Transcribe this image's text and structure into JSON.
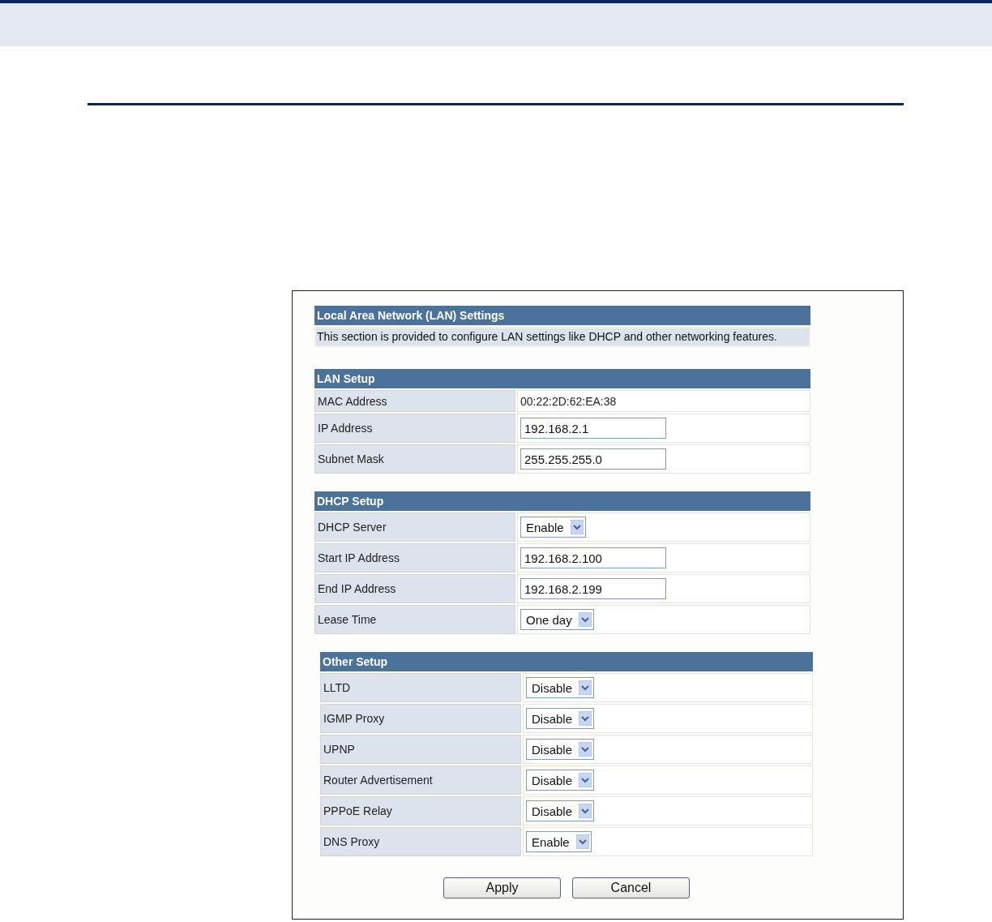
{
  "settings": {
    "title": "Local Area Network (LAN) Settings",
    "description": "This section is provided to configure LAN settings like DHCP and other networking features."
  },
  "sections": [
    {
      "title": "LAN Setup",
      "rows": [
        {
          "label": "MAC Address",
          "kind": "text",
          "value": "00:22:2D:62:EA:38"
        },
        {
          "label": "IP Address",
          "kind": "input",
          "value": "192.168.2.1"
        },
        {
          "label": "Subnet Mask",
          "kind": "input",
          "value": "255.255.255.0"
        }
      ]
    },
    {
      "title": "DHCP Setup",
      "rows": [
        {
          "label": "DHCP Server",
          "kind": "select",
          "value": "Enable"
        },
        {
          "label": "Start IP Address",
          "kind": "input",
          "value": "192.168.2.100"
        },
        {
          "label": "End IP Address",
          "kind": "input",
          "value": "192.168.2.199"
        },
        {
          "label": "Lease Time",
          "kind": "select",
          "value": "One day"
        }
      ]
    },
    {
      "title": "Other Setup",
      "rows": [
        {
          "label": "LLTD",
          "kind": "select",
          "value": "Disable"
        },
        {
          "label": "IGMP Proxy",
          "kind": "select",
          "value": "Disable"
        },
        {
          "label": "UPNP",
          "kind": "select",
          "value": "Disable"
        },
        {
          "label": "Router Advertisement",
          "kind": "select",
          "value": "Disable"
        },
        {
          "label": "PPPoE Relay",
          "kind": "select",
          "value": "Disable"
        },
        {
          "label": "DNS Proxy",
          "kind": "select",
          "value": "Enable"
        }
      ]
    }
  ],
  "buttons": [
    "Apply",
    "Cancel"
  ]
}
